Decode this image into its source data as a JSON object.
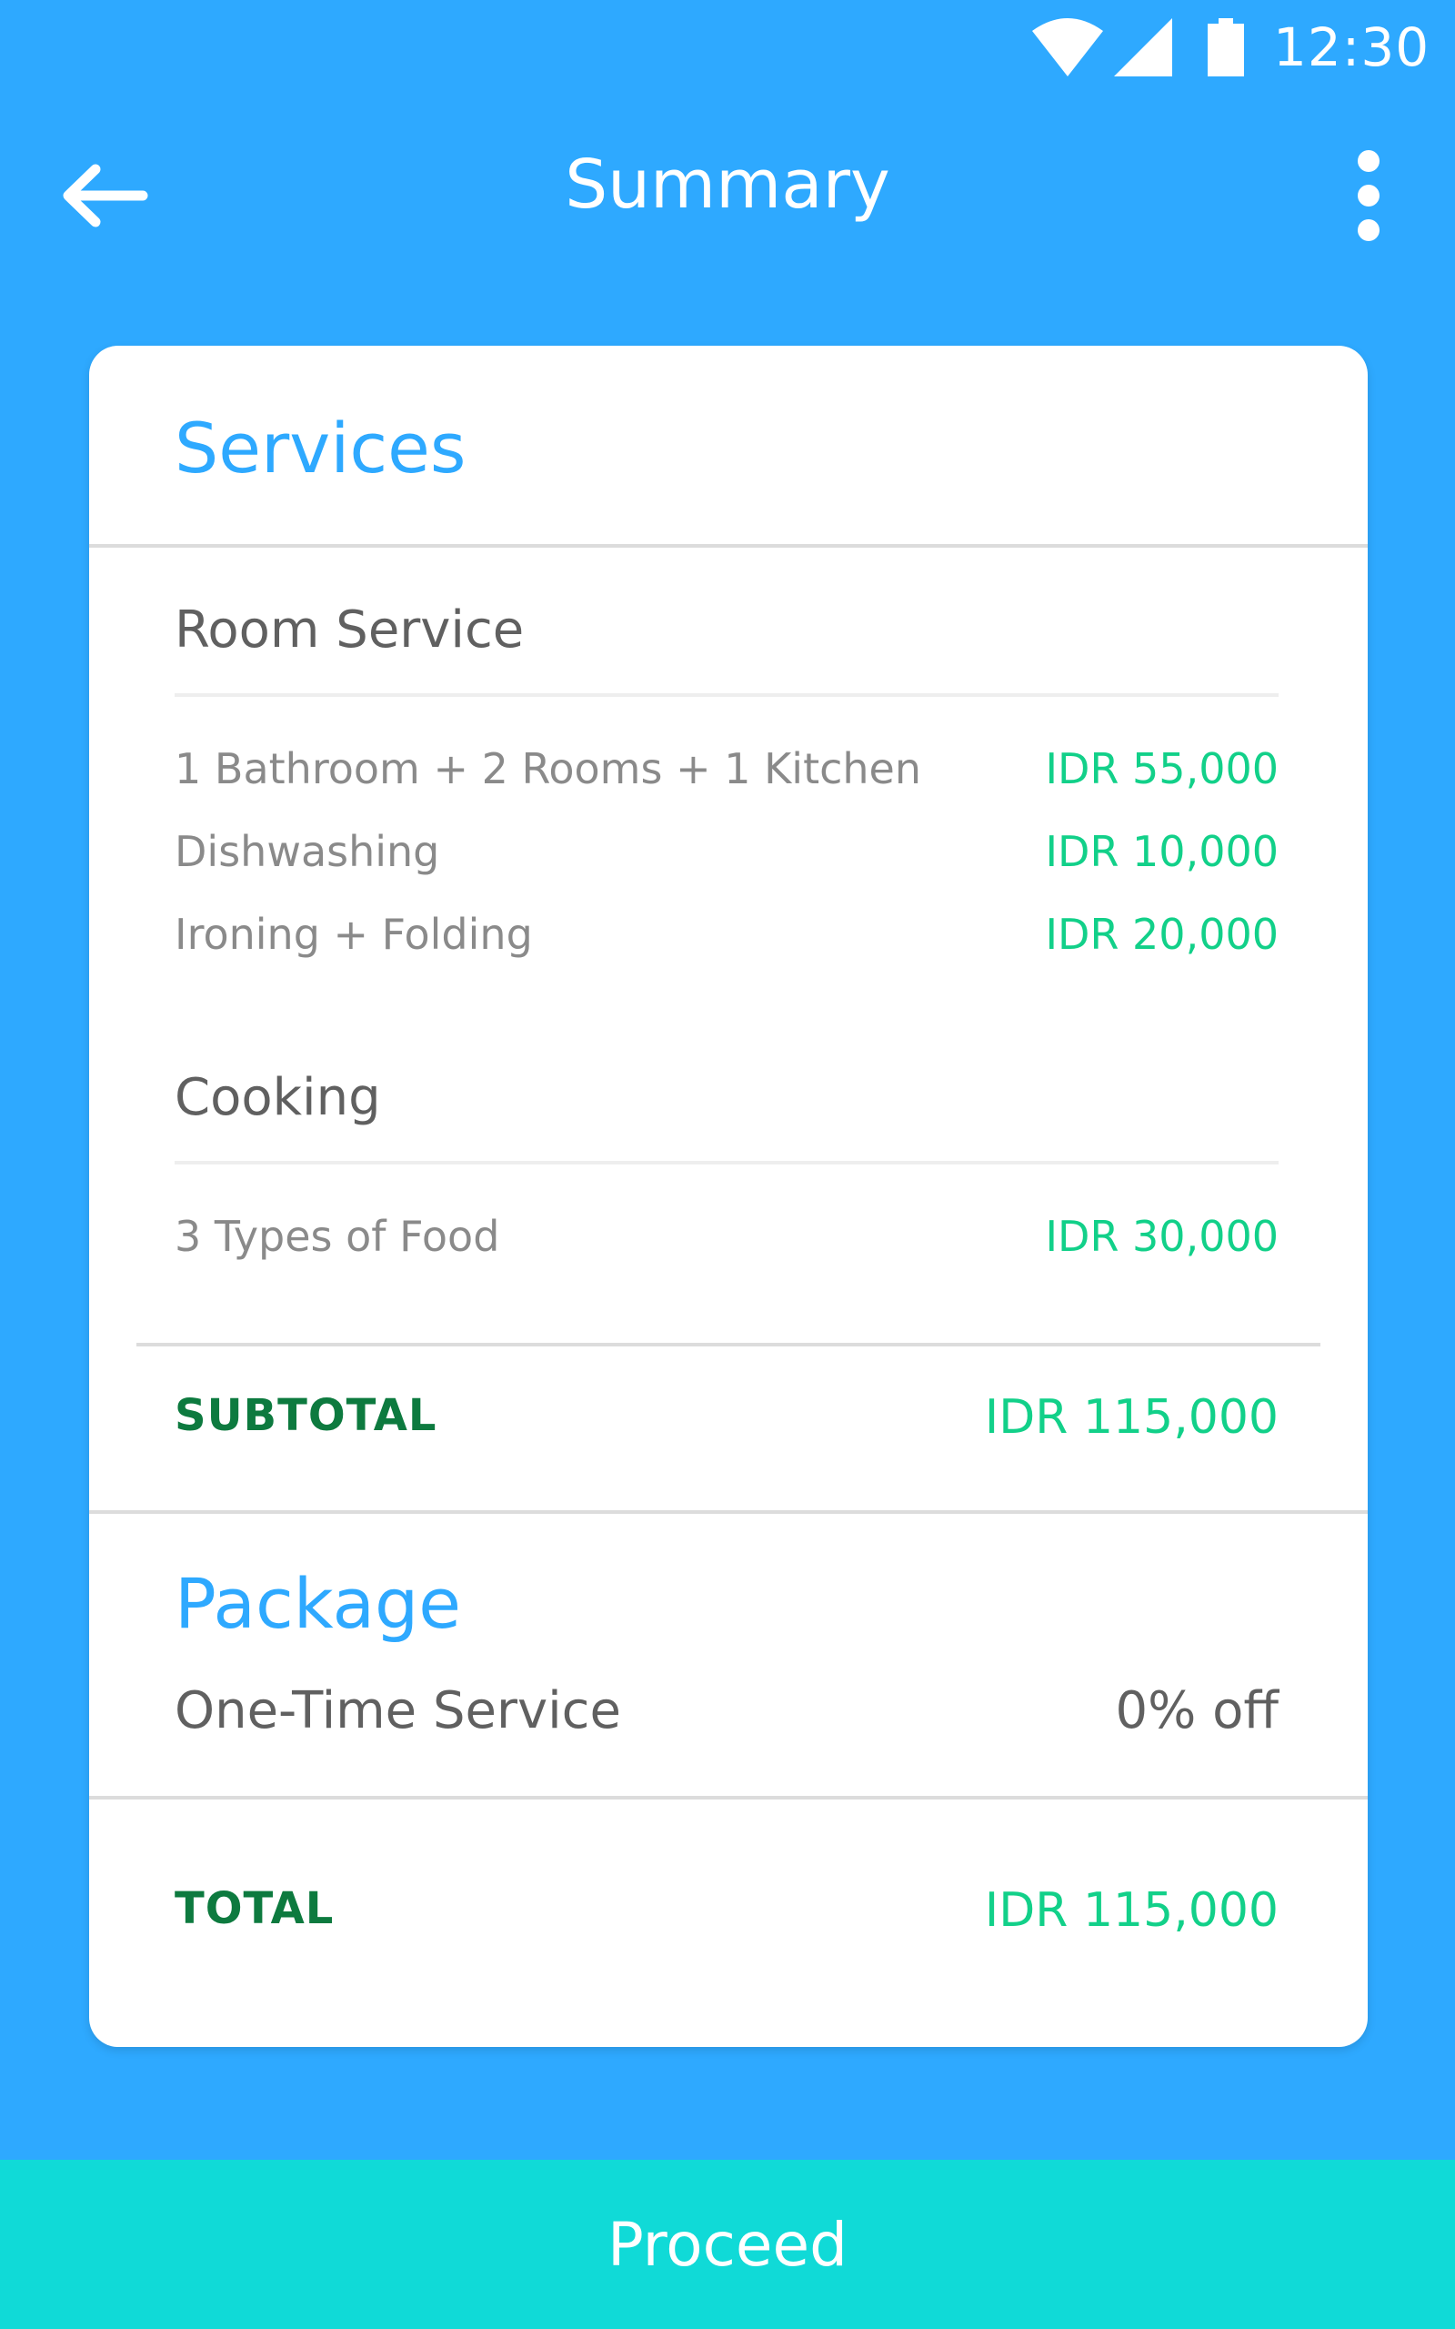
{
  "status_bar": {
    "time": "12:30"
  },
  "app_bar": {
    "title": "Summary"
  },
  "services": {
    "title": "Services",
    "groups": [
      {
        "name": "Room Service",
        "items": [
          {
            "label": "1 Bathroom + 2 Rooms + 1 Kitchen",
            "price": "IDR 55,000"
          },
          {
            "label": "Dishwashing",
            "price": "IDR 10,000"
          },
          {
            "label": "Ironing + Folding",
            "price": "IDR 20,000"
          }
        ]
      },
      {
        "name": "Cooking",
        "items": [
          {
            "label": "3 Types of Food",
            "price": "IDR 30,000"
          }
        ]
      }
    ],
    "subtotal_label": "SUBTOTAL",
    "subtotal_value": "IDR 115,000"
  },
  "package": {
    "title": "Package",
    "name": "One-Time Service",
    "discount": "0% off"
  },
  "total": {
    "label": "TOTAL",
    "value": "IDR 115,000"
  },
  "actions": {
    "proceed_label": "Proceed"
  },
  "colors": {
    "background": "#2ea9ff",
    "accent_blue": "#2ea9ff",
    "price_green": "#12d089",
    "total_label_green": "#0d7a3f",
    "proceed_button": "#10dad7"
  }
}
